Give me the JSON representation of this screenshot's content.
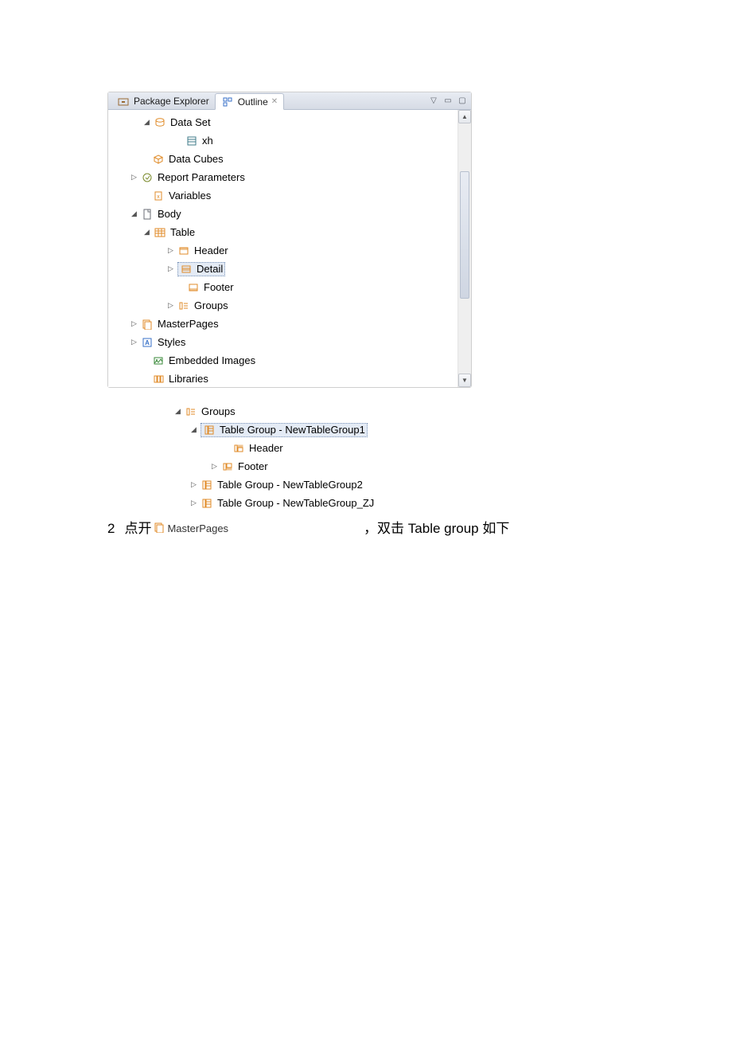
{
  "tabs": {
    "package_explorer": "Package Explorer",
    "outline": "Outline"
  },
  "tree1": {
    "data_set": "Data Set",
    "xh": "xh",
    "data_cubes": "Data Cubes",
    "report_parameters": "Report Parameters",
    "variables": "Variables",
    "body": "Body",
    "table": "Table",
    "header": "Header",
    "detail": "Detail",
    "footer": "Footer",
    "groups": "Groups",
    "master_pages": "MasterPages",
    "styles": "Styles",
    "embedded_images": "Embedded Images",
    "libraries": "Libraries"
  },
  "tree2": {
    "groups": "Groups",
    "tg1": "Table Group - NewTableGroup1",
    "tg1_header": "Header",
    "tg1_footer": "Footer",
    "tg2": "Table Group - NewTableGroup2",
    "tg3": "Table Group - NewTableGroup_ZJ",
    "master_pages_cut": "MasterPages"
  },
  "footer": {
    "num": "2",
    "left": "点开",
    "right": "，双击 Table group  如下"
  }
}
